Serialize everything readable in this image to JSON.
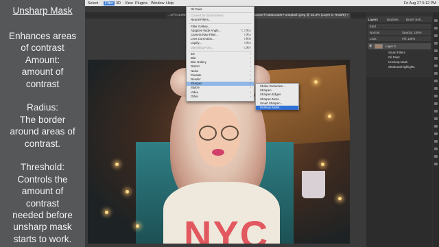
{
  "slide": {
    "title": "Unsharp Mask",
    "lines": [
      "Enhances areas",
      "of contrast",
      "Amount:",
      "amount of",
      "contrast",
      "",
      "Radius:",
      "The border",
      "around areas of",
      "contrast.",
      "",
      "Threshold:",
      "Controls the",
      "amount of",
      "contrast",
      "needed before",
      "unsharp mask",
      "starts to work."
    ]
  },
  "menubar": {
    "items": [
      "Select",
      "Filter",
      "3D",
      "View",
      "Plugins",
      "Window",
      "Help"
    ],
    "status": "Fri Aug 27  5:12 PM"
  },
  "tabs": [
    "...8-f7c4490f2c-unsplash.jpeg @ 12.5% (RGB/8) ×",
    "ali-pazani-fTuEBoxa00Y-unsplash.jpeg @ 33.3% (Layer 0, RGB/8) ×"
  ],
  "filter_menu": {
    "items": [
      {
        "label": "Oil Paint",
        "shortcut": "",
        "arrow": false,
        "disabled": false
      },
      {
        "label": "Convert for Smart Filters",
        "shortcut": "",
        "arrow": false,
        "disabled": true
      },
      {
        "label": "Neural Filters...",
        "shortcut": "",
        "arrow": false,
        "disabled": false
      },
      {
        "label": "Filter Gallery...",
        "shortcut": "",
        "arrow": false,
        "disabled": false
      },
      {
        "label": "Adaptive Wide Angle...",
        "shortcut": "⌥⇧⌘A",
        "arrow": false,
        "disabled": false
      },
      {
        "label": "Camera Raw Filter...",
        "shortcut": "⇧⌘A",
        "arrow": false,
        "disabled": false
      },
      {
        "label": "Lens Correction...",
        "shortcut": "⇧⌘R",
        "arrow": false,
        "disabled": false
      },
      {
        "label": "Liquify...",
        "shortcut": "⇧⌘X",
        "arrow": false,
        "disabled": false
      },
      {
        "label": "Vanishing Point...",
        "shortcut": "⌥⌘V",
        "arrow": false,
        "disabled": true
      },
      {
        "label": "3D",
        "shortcut": "",
        "arrow": true,
        "disabled": false
      },
      {
        "label": "Blur",
        "shortcut": "",
        "arrow": true,
        "disabled": false
      },
      {
        "label": "Blur Gallery",
        "shortcut": "",
        "arrow": true,
        "disabled": false
      },
      {
        "label": "Distort",
        "shortcut": "",
        "arrow": true,
        "disabled": false
      },
      {
        "label": "Noise",
        "shortcut": "",
        "arrow": true,
        "disabled": false
      },
      {
        "label": "Pixelate",
        "shortcut": "",
        "arrow": true,
        "disabled": false
      },
      {
        "label": "Render",
        "shortcut": "",
        "arrow": true,
        "disabled": false
      },
      {
        "label": "Sharpen",
        "shortcut": "",
        "arrow": true,
        "disabled": false
      },
      {
        "label": "Stylize",
        "shortcut": "",
        "arrow": true,
        "disabled": false
      },
      {
        "label": "Video",
        "shortcut": "",
        "arrow": true,
        "disabled": false
      },
      {
        "label": "Other",
        "shortcut": "",
        "arrow": true,
        "disabled": false
      }
    ],
    "submenu": [
      "Shake Reduction...",
      "Sharpen",
      "Sharpen Edges",
      "Sharpen More",
      "Smart Sharpen...",
      "Unsharp Mask..."
    ]
  },
  "panels": {
    "tabs": [
      "Layers",
      "Brushes",
      "Brush Sett.."
    ],
    "kind_label": "Kind",
    "blend_mode": "Normal",
    "opacity_label": "Opacity: 100%",
    "lock_label": "Lock:",
    "fill_label": "Fill: 100%",
    "layers": [
      {
        "name": "Layer 0",
        "sub": false
      },
      {
        "name": "Smart Filters",
        "sub": true
      },
      {
        "name": "Oil Paint",
        "sub": true
      },
      {
        "name": "Unsharp Mask",
        "sub": true
      },
      {
        "name": "Shadows/Highlights",
        "sub": true
      }
    ]
  },
  "photo": {
    "shirt_text": "NYC"
  }
}
